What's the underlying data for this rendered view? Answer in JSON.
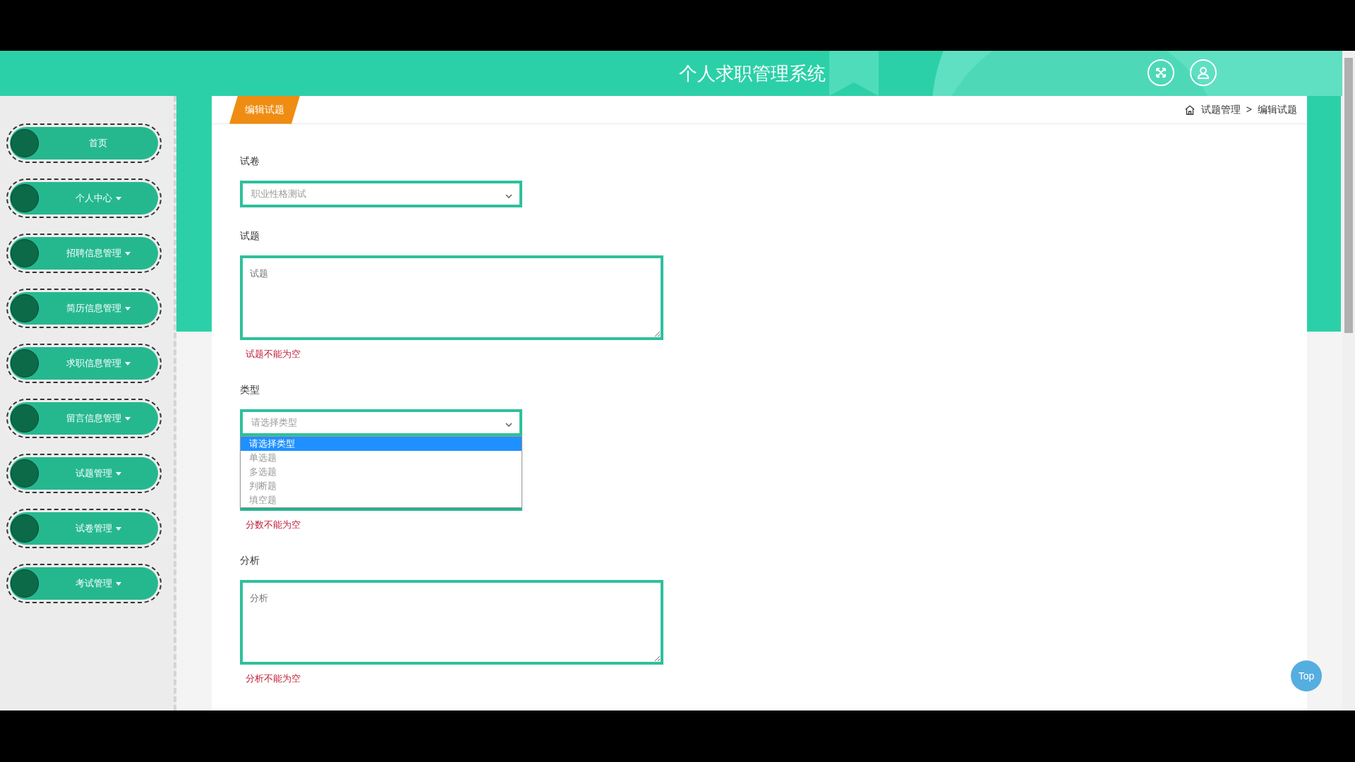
{
  "header": {
    "title": "个人求职管理系统"
  },
  "sidebar": {
    "items": [
      {
        "label": "首页",
        "has_submenu": false
      },
      {
        "label": "个人中心",
        "has_submenu": true
      },
      {
        "label": "招聘信息管理",
        "has_submenu": true
      },
      {
        "label": "简历信息管理",
        "has_submenu": true
      },
      {
        "label": "求职信息管理",
        "has_submenu": true
      },
      {
        "label": "留言信息管理",
        "has_submenu": true
      },
      {
        "label": "试题管理",
        "has_submenu": true
      },
      {
        "label": "试卷管理",
        "has_submenu": true
      },
      {
        "label": "考试管理",
        "has_submenu": true
      }
    ]
  },
  "panel": {
    "tab": "编辑试题",
    "breadcrumb": [
      "试题管理",
      "编辑试题"
    ],
    "breadcrumb_separator": ">"
  },
  "form": {
    "fields": [
      {
        "kind": "select",
        "label": "试卷",
        "value": "职业性格测试"
      },
      {
        "kind": "textarea",
        "label": "试题",
        "placeholder": "试题",
        "error": "试题不能为空"
      },
      {
        "kind": "select",
        "label": "类型",
        "value": "请选择类型",
        "open": true,
        "options": [
          {
            "label": "请选择类型",
            "selected": true
          },
          {
            "label": "单选题",
            "selected": false
          },
          {
            "label": "多选题",
            "selected": false
          },
          {
            "label": "判断题",
            "selected": false
          },
          {
            "label": "填空题",
            "selected": false
          }
        ]
      },
      {
        "kind": "covered_input",
        "error": "分数不能为空"
      },
      {
        "kind": "textarea",
        "label": "分析",
        "placeholder": "分析",
        "error": "分析不能为空"
      }
    ]
  },
  "back_to_top": "Top"
}
